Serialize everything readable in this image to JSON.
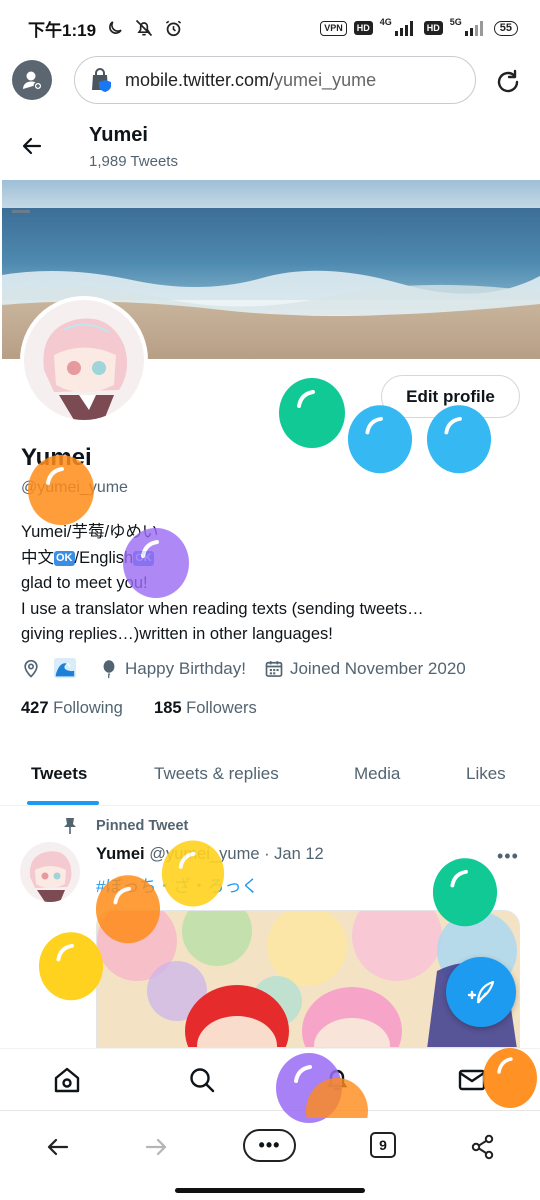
{
  "status_bar": {
    "time": "下午1:19",
    "vpn": "VPN",
    "hd1": "HD",
    "net1": "4G",
    "hd2": "HD",
    "net2": "5G",
    "battery": "55"
  },
  "browser": {
    "url_domain": "mobile.twitter.com/",
    "url_path": "yumei_yume",
    "tab_count": "9",
    "more_label": "•••"
  },
  "header": {
    "name": "Yumei",
    "tweet_count": "1,989 Tweets"
  },
  "profile": {
    "edit_button": "Edit profile",
    "name": "Yumei",
    "handle": "@yumei_yume",
    "bio_line1": "Yumei/芋莓/ゆめい",
    "bio_line2_a": "中文",
    "bio_line2_b": "/English",
    "ok_badge": "OK",
    "bio_line3": "glad to meet you!",
    "bio_line4": "I use a translator when reading texts (sending tweets…",
    "bio_line5": "giving replies…)written in other languages!",
    "birthday": "Happy Birthday!",
    "joined": "Joined November 2020",
    "following_count": "427",
    "following_label": "Following",
    "followers_count": "185",
    "followers_label": "Followers"
  },
  "tabs": {
    "tweets": "Tweets",
    "replies": "Tweets & replies",
    "media": "Media",
    "likes": "Likes"
  },
  "tweet": {
    "pinned_label": "Pinned Tweet",
    "author": "Yumei",
    "handle_date": "@yumei_yume · Jan 12",
    "more": "•••",
    "hashtag": "#ぼっち・ざ・ろっく"
  },
  "colors": {
    "accent": "#1d9bf0",
    "balloon_green": "#10c995",
    "balloon_blue": "#36b8f2",
    "balloon_orange": "#ff8c1a",
    "balloon_purple": "#9b6cf5",
    "balloon_yellow": "#ffd21f"
  }
}
